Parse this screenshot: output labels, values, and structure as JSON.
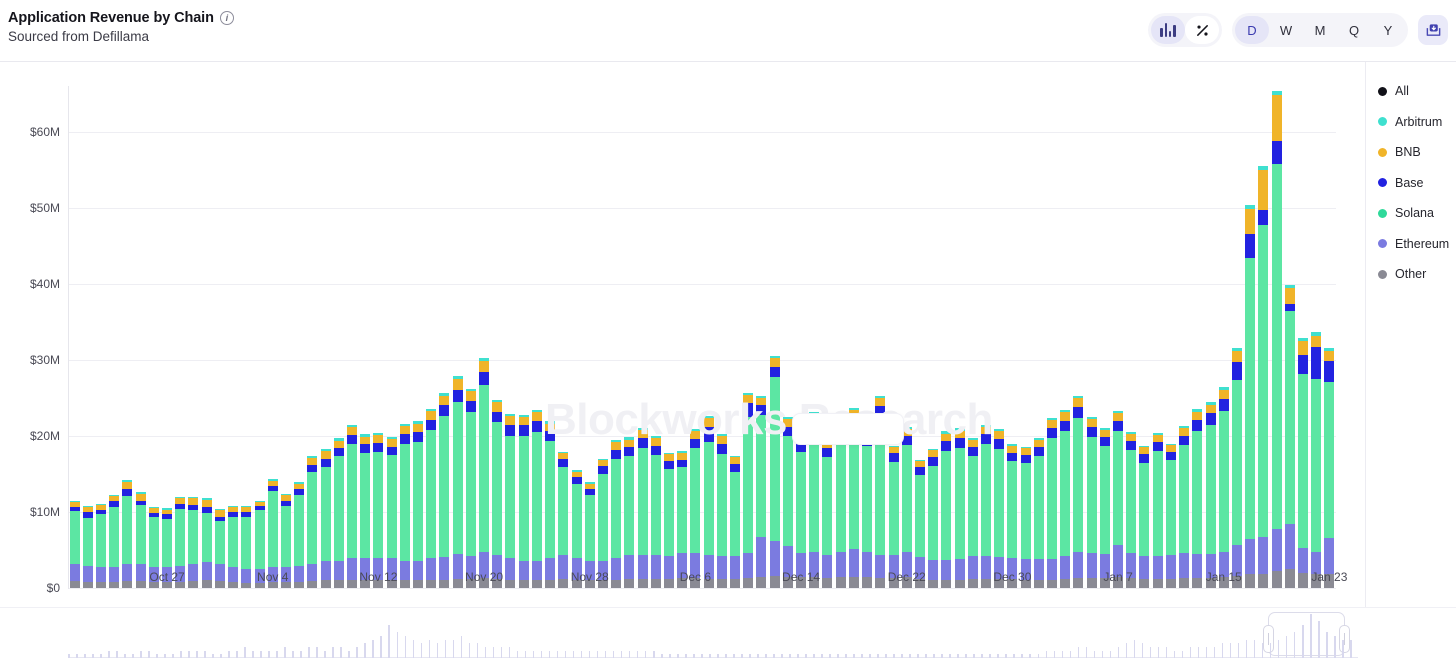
{
  "header": {
    "title": "Application Revenue by Chain",
    "subtitle": "Sourced from Defillama",
    "info_icon": "info-icon"
  },
  "toolbar": {
    "chart_type_buttons": [
      {
        "id": "bar",
        "icon": "bar-chart-icon",
        "active": true
      },
      {
        "id": "percent",
        "icon": "percent-icon",
        "label": "%",
        "active": false
      }
    ],
    "interval_buttons": [
      {
        "label": "D",
        "active": true
      },
      {
        "label": "W",
        "active": false
      },
      {
        "label": "M",
        "active": false
      },
      {
        "label": "Q",
        "active": false
      },
      {
        "label": "Y",
        "active": false
      }
    ],
    "export_icon": "download-icon"
  },
  "watermark": "Blockworks Research",
  "chart_data": {
    "type": "bar",
    "stacked": true,
    "title": "Application Revenue by Chain",
    "subtitle": "Sourced from Defillama",
    "xlabel": "",
    "ylabel": "",
    "ylim": [
      0,
      66
    ],
    "yticks": [
      0,
      10,
      20,
      30,
      40,
      50,
      60
    ],
    "ytick_labels": [
      "$0",
      "$10M",
      "$20M",
      "$30M",
      "$40M",
      "$50M",
      "$60M"
    ],
    "y_unit": "USD millions",
    "grid": true,
    "legend_position": "right",
    "xtick_labels": [
      "Oct 27",
      "Nov 4",
      "Nov 12",
      "Nov 20",
      "Nov 28",
      "Dec 6",
      "Dec 14",
      "Dec 22",
      "Dec 30",
      "Jan 7",
      "Jan 15",
      "Jan 23"
    ],
    "xtick_indices": [
      7,
      15,
      23,
      31,
      39,
      47,
      55,
      63,
      71,
      79,
      87,
      95
    ],
    "x": [
      "Oct 20",
      "Oct 21",
      "Oct 22",
      "Oct 23",
      "Oct 24",
      "Oct 25",
      "Oct 26",
      "Oct 27",
      "Oct 28",
      "Oct 29",
      "Oct 30",
      "Oct 31",
      "Nov 1",
      "Nov 2",
      "Nov 3",
      "Nov 4",
      "Nov 5",
      "Nov 6",
      "Nov 7",
      "Nov 8",
      "Nov 9",
      "Nov 10",
      "Nov 11",
      "Nov 12",
      "Nov 13",
      "Nov 14",
      "Nov 15",
      "Nov 16",
      "Nov 17",
      "Nov 18",
      "Nov 19",
      "Nov 20",
      "Nov 21",
      "Nov 22",
      "Nov 23",
      "Nov 24",
      "Nov 25",
      "Nov 26",
      "Nov 27",
      "Nov 28",
      "Nov 29",
      "Nov 30",
      "Dec 1",
      "Dec 2",
      "Dec 3",
      "Dec 4",
      "Dec 5",
      "Dec 6",
      "Dec 7",
      "Dec 8",
      "Dec 9",
      "Dec 10",
      "Dec 11",
      "Dec 12",
      "Dec 13",
      "Dec 14",
      "Dec 15",
      "Dec 16",
      "Dec 17",
      "Dec 18",
      "Dec 19",
      "Dec 20",
      "Dec 21",
      "Dec 22",
      "Dec 23",
      "Dec 24",
      "Dec 25",
      "Dec 26",
      "Dec 27",
      "Dec 28",
      "Dec 29",
      "Dec 30",
      "Dec 31",
      "Jan 1",
      "Jan 2",
      "Jan 3",
      "Jan 4",
      "Jan 5",
      "Jan 6",
      "Jan 7",
      "Jan 8",
      "Jan 9",
      "Jan 10",
      "Jan 11",
      "Jan 12",
      "Jan 13",
      "Jan 14",
      "Jan 15",
      "Jan 16",
      "Jan 17",
      "Jan 18",
      "Jan 19",
      "Jan 20",
      "Jan 21",
      "Jan 22",
      "Jan 23"
    ],
    "series": [
      {
        "name": "Other",
        "color": "#8a8a94",
        "values": [
          0.9,
          0.8,
          0.8,
          0.8,
          0.9,
          0.9,
          0.8,
          0.8,
          0.8,
          0.9,
          1.0,
          0.9,
          0.8,
          0.7,
          0.7,
          0.8,
          0.8,
          0.8,
          0.9,
          1.0,
          1.0,
          1.1,
          1.1,
          1.1,
          1.1,
          1.0,
          1.0,
          1.1,
          1.1,
          1.2,
          1.2,
          1.3,
          1.2,
          1.1,
          1.0,
          1.0,
          1.1,
          1.2,
          1.1,
          1.0,
          1.0,
          1.1,
          1.2,
          1.2,
          1.2,
          1.2,
          1.3,
          1.3,
          1.2,
          1.2,
          1.2,
          1.3,
          1.5,
          1.6,
          1.5,
          1.4,
          1.4,
          1.3,
          1.4,
          1.5,
          1.4,
          1.3,
          1.3,
          1.4,
          1.2,
          1.1,
          1.1,
          1.1,
          1.2,
          1.2,
          1.2,
          1.2,
          1.1,
          1.1,
          1.1,
          1.2,
          1.3,
          1.3,
          1.3,
          1.4,
          1.3,
          1.2,
          1.2,
          1.2,
          1.3,
          1.3,
          1.3,
          1.4,
          1.6,
          1.8,
          1.9,
          2.3,
          2.5,
          2.0,
          1.8,
          1.9
        ]
      },
      {
        "name": "Ethereum",
        "color": "#7b7be0",
        "values": [
          2.2,
          2.1,
          2.0,
          2.0,
          2.2,
          2.3,
          2.0,
          1.9,
          2.1,
          2.2,
          2.4,
          2.2,
          1.9,
          1.8,
          1.8,
          2.0,
          2.0,
          2.1,
          2.3,
          2.6,
          2.6,
          2.9,
          2.8,
          2.8,
          2.9,
          2.6,
          2.6,
          2.9,
          3.0,
          3.3,
          3.0,
          3.4,
          3.1,
          2.8,
          2.5,
          2.5,
          2.8,
          3.1,
          2.8,
          2.6,
          2.5,
          2.8,
          3.2,
          3.2,
          3.1,
          3.0,
          3.3,
          3.3,
          3.1,
          3.0,
          3.0,
          3.3,
          5.2,
          4.6,
          4.0,
          3.2,
          3.3,
          3.1,
          3.4,
          3.6,
          3.3,
          3.0,
          3.1,
          3.4,
          2.9,
          2.6,
          2.6,
          2.7,
          3.0,
          3.0,
          2.9,
          2.8,
          2.7,
          2.7,
          2.7,
          3.0,
          3.4,
          3.3,
          3.2,
          4.3,
          3.3,
          3.0,
          3.0,
          3.1,
          3.3,
          3.2,
          3.2,
          3.4,
          4.1,
          4.6,
          4.8,
          5.5,
          5.9,
          3.2,
          3.0,
          4.7
        ]
      },
      {
        "name": "Solana",
        "color": "#5ce6a3",
        "values": [
          7.0,
          6.3,
          6.9,
          7.8,
          9.0,
          7.7,
          6.5,
          6.4,
          7.5,
          7.1,
          6.5,
          5.7,
          6.7,
          6.9,
          7.7,
          9.9,
          8.0,
          9.3,
          12.0,
          12.3,
          13.7,
          14.9,
          13.8,
          14.0,
          13.5,
          15.3,
          15.6,
          16.8,
          18.5,
          20.0,
          19.0,
          22.0,
          17.5,
          16.1,
          16.5,
          17.0,
          15.4,
          11.6,
          9.8,
          8.6,
          11.5,
          13.1,
          12.9,
          14.0,
          13.2,
          11.5,
          11.3,
          13.8,
          14.9,
          13.4,
          11.0,
          17.9,
          16.0,
          21.6,
          14.5,
          13.3,
          15.5,
          12.8,
          14.8,
          15.7,
          14.0,
          18.0,
          12.2,
          14.0,
          10.8,
          12.4,
          14.3,
          14.6,
          13.2,
          14.7,
          14.2,
          12.7,
          12.6,
          13.5,
          15.9,
          16.4,
          17.6,
          15.3,
          14.2,
          15.0,
          13.5,
          12.3,
          13.8,
          12.5,
          14.2,
          16.2,
          17.0,
          18.5,
          21.6,
          37.0,
          41.0,
          48.0,
          28.0,
          22.9,
          22.7,
          20.5
        ]
      },
      {
        "name": "Base",
        "color": "#2222e0",
        "values": [
          0.6,
          0.8,
          0.6,
          0.8,
          0.9,
          0.6,
          0.6,
          0.6,
          0.7,
          0.7,
          0.7,
          0.6,
          0.6,
          0.6,
          0.6,
          0.7,
          0.7,
          0.8,
          1.0,
          1.1,
          1.1,
          1.2,
          1.2,
          1.2,
          1.1,
          1.3,
          1.3,
          1.3,
          1.4,
          1.6,
          1.4,
          1.7,
          1.4,
          1.4,
          1.4,
          1.4,
          1.3,
          1.0,
          0.9,
          0.8,
          1.0,
          1.2,
          1.2,
          1.3,
          1.2,
          1.0,
          1.0,
          1.2,
          2.0,
          1.4,
          1.1,
          1.8,
          1.3,
          1.3,
          1.2,
          1.3,
          1.5,
          1.2,
          1.4,
          1.5,
          1.3,
          1.6,
          1.1,
          1.2,
          1.0,
          1.1,
          1.3,
          1.3,
          1.2,
          1.3,
          1.3,
          1.1,
          1.1,
          1.2,
          1.4,
          1.4,
          1.5,
          1.3,
          1.2,
          1.3,
          1.2,
          1.1,
          1.2,
          1.1,
          1.2,
          1.4,
          1.5,
          1.6,
          2.4,
          3.2,
          2.0,
          3.0,
          1.0,
          2.5,
          4.2,
          2.7
        ]
      },
      {
        "name": "BNB",
        "color": "#f0b429",
        "values": [
          0.6,
          0.6,
          0.6,
          0.7,
          1.0,
          0.9,
          0.6,
          0.6,
          0.7,
          0.9,
          1.0,
          0.8,
          0.6,
          0.6,
          0.5,
          0.7,
          0.7,
          0.7,
          0.9,
          1.0,
          1.0,
          1.1,
          1.0,
          1.0,
          1.0,
          1.1,
          1.1,
          1.2,
          1.3,
          1.4,
          1.3,
          1.5,
          1.2,
          1.2,
          1.1,
          1.2,
          1.0,
          0.8,
          0.7,
          0.7,
          0.8,
          1.0,
          1.0,
          1.1,
          1.0,
          0.9,
          0.9,
          1.0,
          1.1,
          1.0,
          0.9,
          1.1,
          1.0,
          1.1,
          1.0,
          1.0,
          1.1,
          0.9,
          1.0,
          1.1,
          1.0,
          1.1,
          0.8,
          0.9,
          0.8,
          0.9,
          1.0,
          1.0,
          0.9,
          1.0,
          1.0,
          0.9,
          0.9,
          0.9,
          1.0,
          1.1,
          1.2,
          1.0,
          0.9,
          1.0,
          0.9,
          0.9,
          0.9,
          0.9,
          1.0,
          1.1,
          1.1,
          1.2,
          1.5,
          3.2,
          5.3,
          6.0,
          2.0,
          1.9,
          1.5,
          1.4
        ]
      },
      {
        "name": "Arbitrum",
        "color": "#3fe0cf",
        "values": [
          0.2,
          0.2,
          0.2,
          0.2,
          0.2,
          0.2,
          0.2,
          0.2,
          0.2,
          0.2,
          0.2,
          0.2,
          0.2,
          0.2,
          0.2,
          0.2,
          0.2,
          0.2,
          0.2,
          0.3,
          0.3,
          0.3,
          0.3,
          0.3,
          0.3,
          0.3,
          0.3,
          0.3,
          0.3,
          0.4,
          0.3,
          0.4,
          0.3,
          0.3,
          0.3,
          0.3,
          0.3,
          0.2,
          0.2,
          0.2,
          0.2,
          0.3,
          0.3,
          0.3,
          0.3,
          0.2,
          0.2,
          0.3,
          0.3,
          0.3,
          0.2,
          0.3,
          0.3,
          0.3,
          0.3,
          0.3,
          0.3,
          0.2,
          0.3,
          0.3,
          0.3,
          0.3,
          0.2,
          0.3,
          0.2,
          0.2,
          0.3,
          0.3,
          0.2,
          0.3,
          0.3,
          0.2,
          0.2,
          0.3,
          0.3,
          0.3,
          0.3,
          0.3,
          0.3,
          0.3,
          0.3,
          0.2,
          0.3,
          0.2,
          0.3,
          0.3,
          0.3,
          0.3,
          0.4,
          0.5,
          0.5,
          0.6,
          0.4,
          0.4,
          0.4,
          0.4
        ]
      }
    ]
  },
  "legend": {
    "items": [
      {
        "label": "All",
        "color": "#111118"
      },
      {
        "label": "Arbitrum",
        "color": "#3fe0cf"
      },
      {
        "label": "BNB",
        "color": "#f0b429"
      },
      {
        "label": "Base",
        "color": "#2222e0"
      },
      {
        "label": "Solana",
        "color": "#2fd99a"
      },
      {
        "label": "Ethereum",
        "color": "#7b7be0"
      },
      {
        "label": "Other",
        "color": "#8a8a94"
      }
    ]
  },
  "brush": {
    "selection_start_pct": 93.0,
    "selection_end_pct": 99.0,
    "overview_values": [
      1,
      1,
      1,
      1,
      1,
      2,
      2,
      1,
      1,
      2,
      2,
      1,
      1,
      1,
      2,
      2,
      2,
      2,
      1,
      1,
      2,
      2,
      3,
      2,
      2,
      2,
      2,
      3,
      2,
      2,
      3,
      3,
      2,
      3,
      3,
      2,
      3,
      4,
      5,
      6,
      9,
      7,
      6,
      5,
      4,
      5,
      4,
      5,
      5,
      6,
      4,
      4,
      3,
      3,
      3,
      3,
      2,
      2,
      2,
      2,
      2,
      2,
      2,
      2,
      2,
      2,
      2,
      2,
      2,
      2,
      2,
      2,
      2,
      2,
      1,
      1,
      1,
      1,
      1,
      1,
      1,
      1,
      1,
      1,
      1,
      1,
      1,
      1,
      1,
      1,
      1,
      1,
      1,
      1,
      1,
      1,
      1,
      1,
      1,
      1,
      1,
      1,
      1,
      1,
      1,
      1,
      1,
      1,
      1,
      1,
      1,
      1,
      1,
      1,
      1,
      1,
      1,
      1,
      1,
      1,
      1,
      1,
      2,
      2,
      2,
      2,
      3,
      3,
      2,
      2,
      2,
      3,
      4,
      5,
      4,
      3,
      3,
      3,
      2,
      2,
      3,
      3,
      3,
      3,
      4,
      4,
      4,
      5,
      5,
      4,
      4,
      5,
      6,
      7,
      9,
      12,
      10,
      7,
      6,
      5,
      5
    ]
  }
}
